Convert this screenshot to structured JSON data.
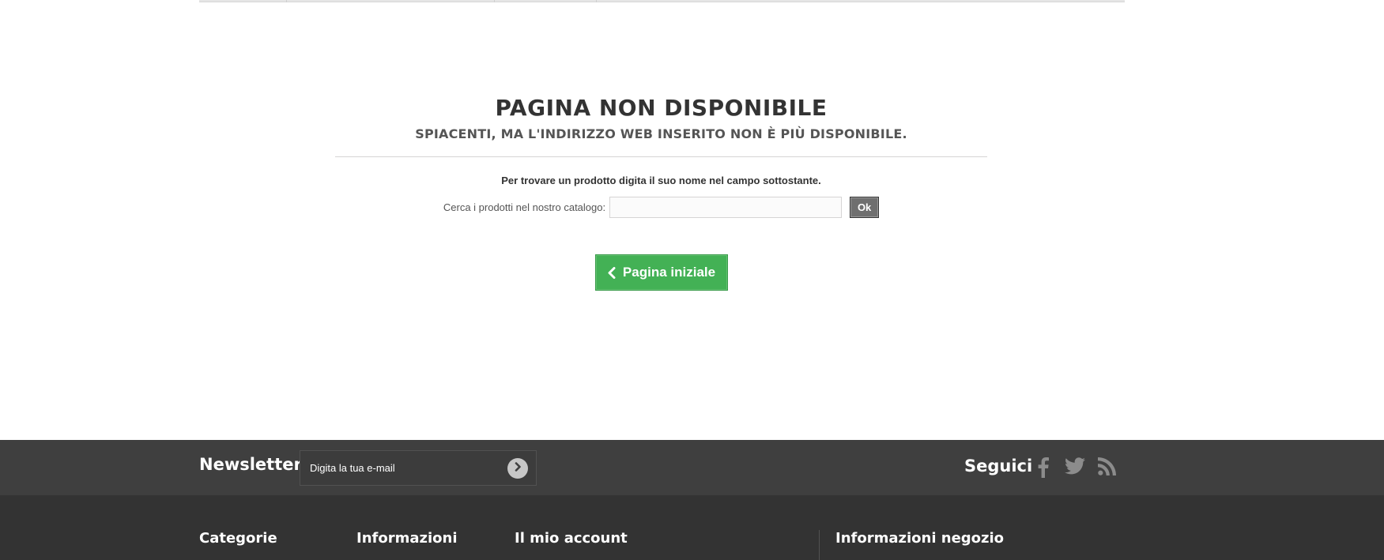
{
  "main": {
    "title": "PAGINA NON DISPONIBILE",
    "subtitle": "SPIACENTI, MA L'INDIRIZZO WEB INSERITO NON È PIÙ DISPONIBILE.",
    "hint": "Per trovare un prodotto digita il suo nome nel campo sottostante.",
    "search": {
      "label": "Cerca i prodotti nel nostro catalogo:",
      "value": "",
      "button_label": "Ok"
    },
    "home_button_label": "Pagina iniziale"
  },
  "newsletter": {
    "title": "Newsletter",
    "input_value": "Digita la tua e-mail"
  },
  "social": {
    "label": "Seguici",
    "icons": [
      "facebook-icon",
      "twitter-icon",
      "rss-icon"
    ]
  },
  "footer": {
    "columns": [
      "Categorie",
      "Informazioni",
      "Il mio account",
      "Informazioni negozio"
    ]
  },
  "colors": {
    "accent_green": "#43b155",
    "newsletter_bg": "#3f3f3f",
    "footer_bg": "#333333"
  }
}
